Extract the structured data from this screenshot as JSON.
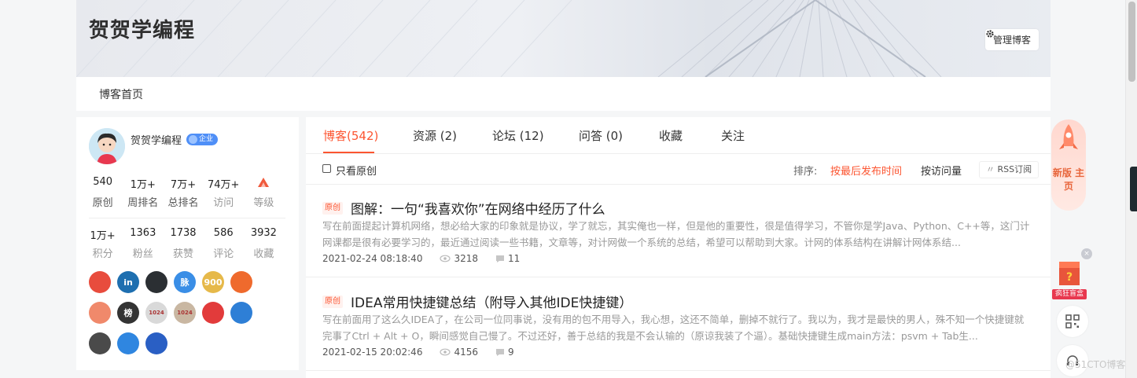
{
  "header": {
    "blog_title": "贺贺学编程",
    "manage_label": "管理博客"
  },
  "nav": {
    "home": "博客首页"
  },
  "profile": {
    "username": "贺贺学编程",
    "badge": "企业",
    "stats_row1": [
      {
        "value": "540",
        "label": "原创"
      },
      {
        "value": "1万+",
        "label": "周排名"
      },
      {
        "value": "7万+",
        "label": "总排名"
      },
      {
        "value": "74万+",
        "label": "访问"
      },
      {
        "value": "",
        "label": "等级"
      }
    ],
    "stats_row2": [
      {
        "value": "1万+",
        "label": "积分"
      },
      {
        "value": "1363",
        "label": "粉丝"
      },
      {
        "value": "1738",
        "label": "获赞"
      },
      {
        "value": "586",
        "label": "评论"
      },
      {
        "value": "3932",
        "label": "收藏"
      }
    ],
    "badges": [
      {
        "icon": "mascot-badge-icon",
        "color": "#e84c3d",
        "text": ""
      },
      {
        "icon": "linkedin-badge-icon",
        "color": "#1e6fb0",
        "text": "in"
      },
      {
        "icon": "github-badge-icon",
        "color": "#2b2f33",
        "text": ""
      },
      {
        "icon": "network-badge-icon",
        "color": "#3a8ee6",
        "text": "脉"
      },
      {
        "icon": "check-in-badge-icon",
        "color": "#e6b94a",
        "text": "900"
      },
      {
        "icon": "upvote-badge-icon",
        "color": "#ef6a2d",
        "text": ""
      },
      {
        "icon": "idol-badge-icon",
        "color": "#f0896b",
        "text": ""
      },
      {
        "icon": "hexagon-badge-icon",
        "color": "#333333",
        "text": "榜"
      },
      {
        "icon": "1024-badge-icon",
        "color": "#d9d9d9",
        "text": "1024"
      },
      {
        "icon": "1024-gold-badge-icon",
        "color": "#c9b7a2",
        "text": "1024"
      },
      {
        "icon": "pen-badge-icon",
        "color": "#e23b3b",
        "text": ""
      },
      {
        "icon": "book-badge-icon",
        "color": "#2e7fd6",
        "text": ""
      },
      {
        "icon": "level-badge-icon",
        "color": "#4a4a4a",
        "text": ""
      },
      {
        "icon": "shield-badge-icon",
        "color": "#2f86e0",
        "text": ""
      },
      {
        "icon": "rocket-badge-icon",
        "color": "#2a5fc4",
        "text": ""
      }
    ]
  },
  "tabs": [
    {
      "label": "博客(542)",
      "active": true
    },
    {
      "label": "资源 (2)"
    },
    {
      "label": "论坛 (12)"
    },
    {
      "label": "问答 (0)"
    },
    {
      "label": "收藏"
    },
    {
      "label": "关注"
    }
  ],
  "filter": {
    "only_original": "只看原创",
    "sort_label": "排序:",
    "sort_active": "按最后发布时间",
    "sort_other": "按访问量",
    "rss": "RSS订阅"
  },
  "articles": [
    {
      "tag": "原创",
      "title": "图解：一句“我喜欢你”在网络中经历了什么",
      "desc": "写在前面提起计算机网络，想必给大家的印象就是协议，学了就忘，其实俺也一样，但是他的重要性，很是值得学习，不管你是学Java、Python、C++等，这门计网课都是很有必要学习的，最近通过阅读一些书籍，文章等，对计网做一个系统的总结，希望可以帮助到大家。计网的体系结构在讲解计网体系结...",
      "date": "2021-02-24 08:18:40",
      "views": "3218",
      "comments": "11"
    },
    {
      "tag": "原创",
      "title": "IDEA常用快捷键总结（附导入其他IDE快捷键）",
      "desc": "写在前面用了这么久IDEA了，在公司一位同事说，没有用的包不用导入，我心想，这还不简单，删掉不就行了。我以为，我才是最快的男人，殊不知一个快捷键就完事了Ctrl + Alt + O，瞬间感觉自己慢了。不过还好，善于总结的我是不会认输的（原谅我装了个逼）。基础快捷键生成main方法：psvm + Tab生...",
      "date": "2021-02-15 20:02:46",
      "views": "4156",
      "comments": "9"
    }
  ],
  "float": {
    "promo": "新版 主页",
    "box_label": "疯狂盲盒",
    "watermark": "@51CTO博客"
  }
}
